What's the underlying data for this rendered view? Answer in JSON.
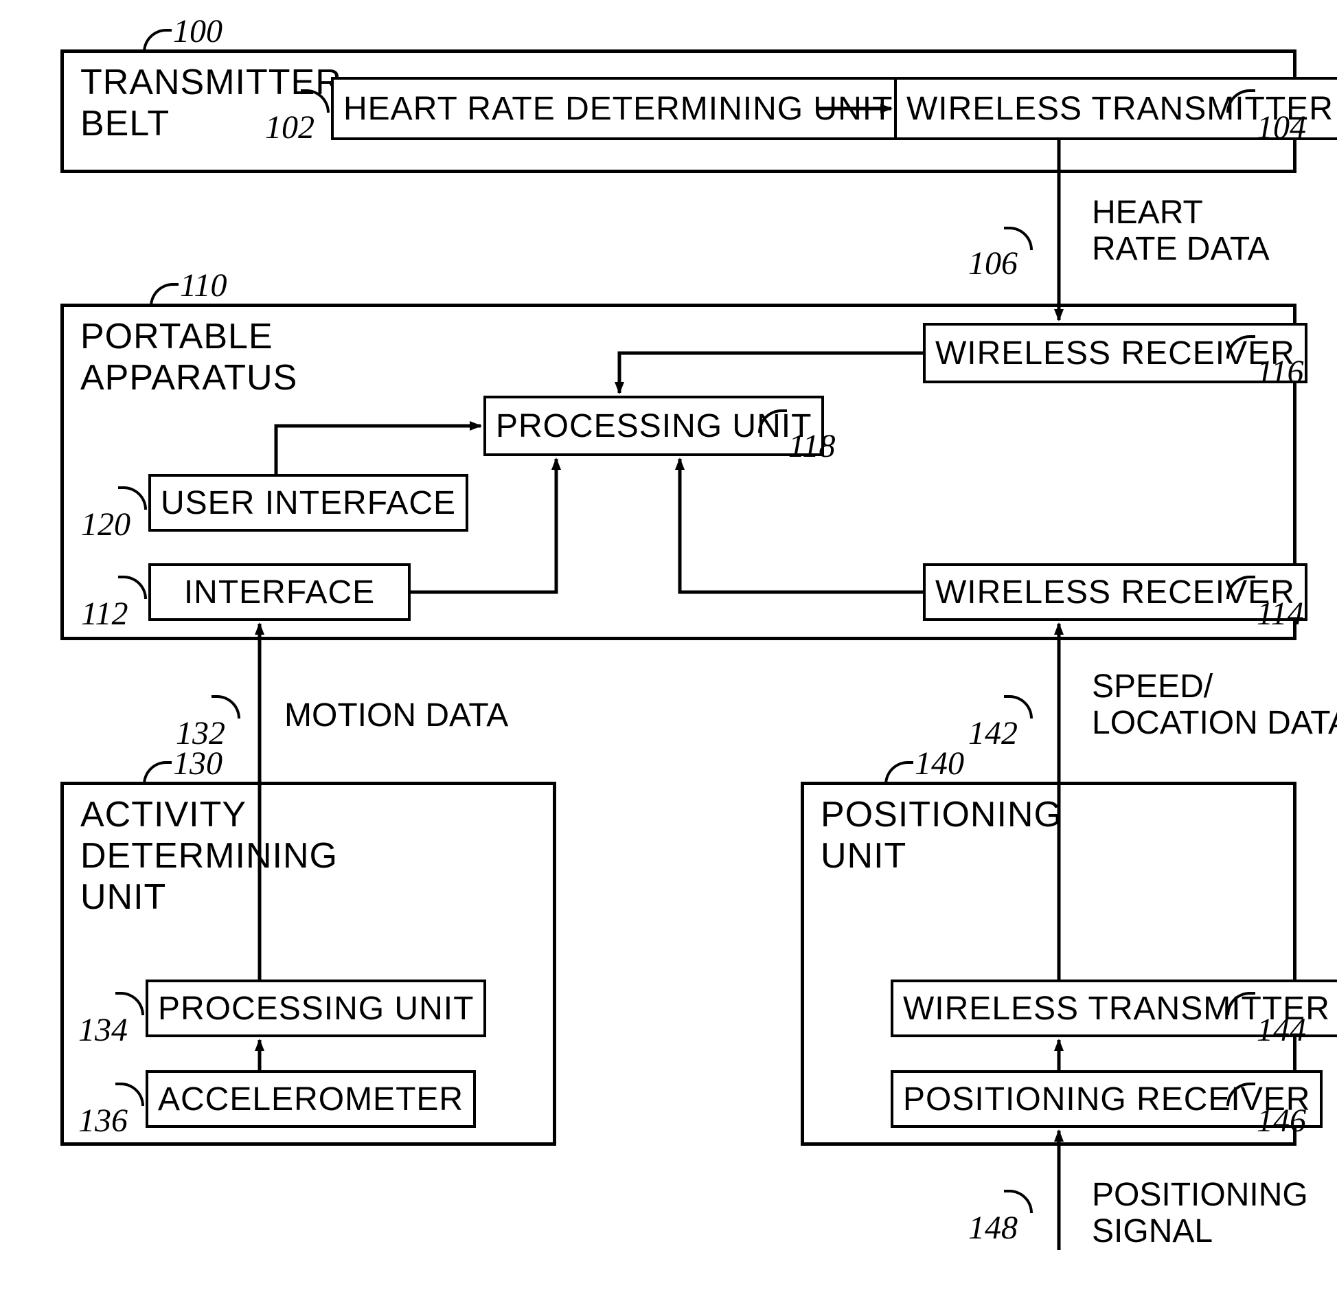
{
  "blocks": {
    "transmitter_belt": {
      "title": "TRANSMITTER\nBELT",
      "ref": "100",
      "hr_unit": {
        "label": "HEART RATE  DETERMINING UNIT",
        "ref": "102"
      },
      "tx": {
        "label": "WIRELESS TRANSMITTER",
        "ref": "104"
      }
    },
    "portable_apparatus": {
      "title": "PORTABLE\nAPPARATUS",
      "ref": "110",
      "wrx1": {
        "label": "WIRELESS RECEIVER",
        "ref": "116"
      },
      "proc": {
        "label": "PROCESSING UNIT",
        "ref": "118"
      },
      "ui": {
        "label": "USER INTERFACE",
        "ref": "120"
      },
      "iface": {
        "label": "INTERFACE",
        "ref": "112"
      },
      "wrx2": {
        "label": "WIRELESS RECEIVER",
        "ref": "114"
      }
    },
    "activity_unit": {
      "title": "ACTIVITY\nDETERMINING\nUNIT",
      "ref": "130",
      "proc": {
        "label": "PROCESSING UNIT",
        "ref": "134"
      },
      "accel": {
        "label": "ACCELEROMETER",
        "ref": "136"
      }
    },
    "positioning_unit": {
      "title": "POSITIONING\nUNIT",
      "ref": "140",
      "tx": {
        "label": "WIRELESS TRANSMITTER",
        "ref": "144"
      },
      "rx": {
        "label": "POSITIONING RECEIVER",
        "ref": "146"
      }
    }
  },
  "signals": {
    "heart_rate": {
      "label": "HEART\nRATE DATA",
      "ref": "106"
    },
    "motion": {
      "label": "MOTION DATA",
      "ref": "132"
    },
    "speed_loc": {
      "label": "SPEED/\nLOCATION DATA",
      "ref": "142"
    },
    "pos_signal": {
      "label": "POSITIONING\nSIGNAL",
      "ref": "148"
    }
  }
}
